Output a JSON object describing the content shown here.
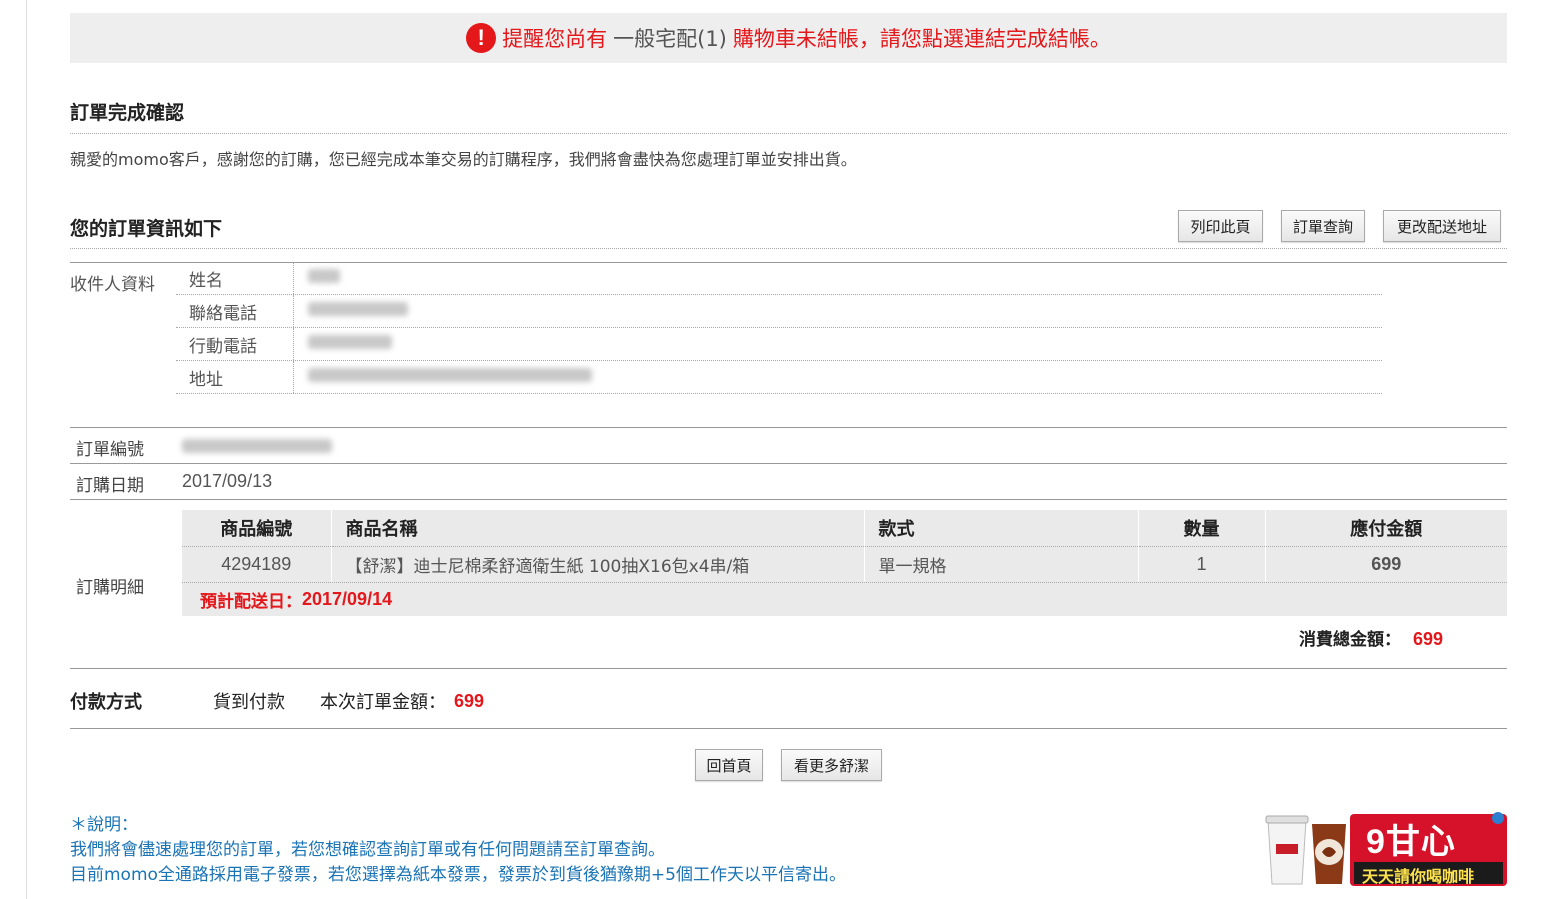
{
  "alert": {
    "icon": "exclamation-icon",
    "part1": "提醒您尚有",
    "part2": "一般宅配(1)",
    "part3": "購物車未結帳，請您點選連結完成結帳。"
  },
  "confirm": {
    "title": "訂單完成確認",
    "message": "親愛的momo客戶，感謝您的訂購，您已經完成本筆交易的訂購程序，我們將會盡快為您處理訂單並安排出貨。"
  },
  "order_info": {
    "title": "您的訂單資訊如下",
    "buttons": {
      "print": "列印此頁",
      "query": "訂單查詢",
      "change_address": "更改配送地址"
    }
  },
  "recipient": {
    "section_label": "收件人資料",
    "rows": [
      {
        "label": "姓名"
      },
      {
        "label": "聯絡電話"
      },
      {
        "label": "行動電話"
      },
      {
        "label": "地址"
      }
    ]
  },
  "order": {
    "number_label": "訂單編號",
    "date_label": "訂購日期",
    "date": "2017/09/13",
    "detail_label": "訂購明細"
  },
  "items": {
    "headers": [
      "商品編號",
      "商品名稱",
      "款式",
      "數量",
      "應付金額"
    ],
    "rows": [
      {
        "id": "4294189",
        "name": "【舒潔】迪士尼棉柔舒適衛生紙 100抽X16包x4串/箱",
        "style": "單一規格",
        "qty": "1",
        "amount": "699"
      }
    ],
    "delivery_label": "預計配送日：",
    "delivery_date": "2017/09/14"
  },
  "totals": {
    "label": "消費總金額：",
    "value": "699"
  },
  "payment": {
    "label": "付款方式",
    "method": "貨到付款",
    "amount_label": "本次訂單金額：",
    "amount": "699"
  },
  "bottom_buttons": {
    "home": "回首頁",
    "more": "看更多舒潔"
  },
  "notes": {
    "title": "＊說明：",
    "line1": "我們將會儘速處理您的訂單，若您想確認查詢訂單或有任何問題請至訂單查詢。",
    "line2": "目前momo全通路採用電子發票，若您選擇為紙本發票，發票於到貨後猶豫期+5個工作天以平信寄出。"
  },
  "ad": {
    "big": "9甘心",
    "small": "天天請你喝咖啡"
  },
  "colors": {
    "accent_red": "#e4171b",
    "note_blue": "#1a73b5",
    "table_bg": "#eaeaea"
  }
}
